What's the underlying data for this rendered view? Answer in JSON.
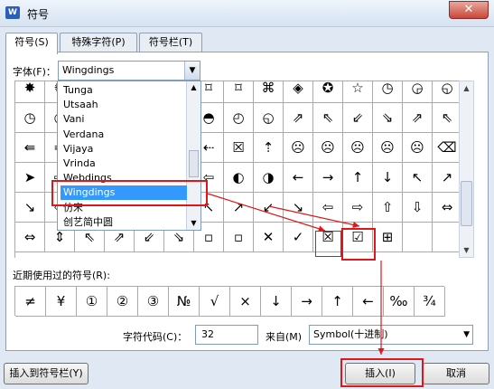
{
  "window": {
    "title": "符号",
    "app_icon": "W",
    "close_label": "✕"
  },
  "tabs": [
    {
      "label": "符号(S)"
    },
    {
      "label": "特殊字符(P)"
    },
    {
      "label": "符号栏(T)"
    }
  ],
  "font": {
    "label": "字体(F)：",
    "value": "Wingdings",
    "list": [
      "Tunga",
      "Utsaah",
      "Vani",
      "Verdana",
      "Vijaya",
      "Vrinda",
      "Webdings",
      "Wingdings",
      "仿宋",
      "创艺简中圆"
    ],
    "selected_index": 7
  },
  "symbol_grid": [
    [
      "✸",
      "✺",
      "☸",
      "✦",
      "❖",
      "⌑",
      "⌑",
      "⌑",
      "⌘",
      "◈",
      "✪",
      "☆",
      "◷",
      "◶",
      "◵",
      "◴"
    ],
    [
      "◷",
      "◔",
      "◕",
      "◑",
      "◐",
      "◒",
      "◓",
      "◴",
      "◵",
      "⇗",
      "⇖",
      "⇙",
      "⇘",
      "⇗",
      "⇖",
      "⇙"
    ],
    [
      "⇚",
      "⇛",
      "⇜",
      "⇝",
      "⇞",
      "⇟",
      "⇠",
      "☒",
      "⇡",
      "☹",
      "☹",
      "☹",
      "☹",
      "☹",
      "⌫",
      "⌦"
    ],
    [
      "➤",
      "⇨",
      "⇦",
      "⇧",
      "⇩",
      "⇨",
      "⇦",
      "◐",
      "◑",
      "←",
      "→",
      "↑",
      "↓",
      "↖",
      "↗",
      "↙"
    ],
    [
      "↘",
      "⇦",
      "⇨",
      "⇧",
      "⇩",
      "⇦",
      "↖",
      "↗",
      "↙",
      "↘",
      "⇦",
      "⇨",
      "⇧",
      "⇩",
      "⇔",
      "⇕"
    ],
    [
      "⇔",
      "⇕",
      "⇖",
      "⇗",
      "⇙",
      "⇘",
      "▫",
      "▫",
      "✕",
      "✓",
      "☒",
      "☑",
      "⊞",
      "",
      "",
      ""
    ]
  ],
  "recent": {
    "label": "近期使用过的符号(R):",
    "symbols": [
      "≠",
      "¥",
      "①",
      "②",
      "③",
      "№",
      "√",
      "×",
      "↓",
      "→",
      "↑",
      "←",
      "‰",
      "¾"
    ]
  },
  "char_code": {
    "label": "字符代码(C)：",
    "value": "32"
  },
  "from": {
    "label": "来自(M)",
    "value": "Symbol(十进制)",
    "caret": "▼"
  },
  "buttons": {
    "insert_to_bar": "插入到符号栏(Y)",
    "insert": "插入(I)",
    "cancel": "取消"
  },
  "colors": {
    "annotation": "#e0161a",
    "selection": "#3399ff"
  },
  "icons": {
    "close": "close-icon",
    "dropdown": "chevron-down-icon",
    "scroll_up": "scroll-up-arrow-icon",
    "scroll_down": "scroll-down-arrow-icon"
  }
}
